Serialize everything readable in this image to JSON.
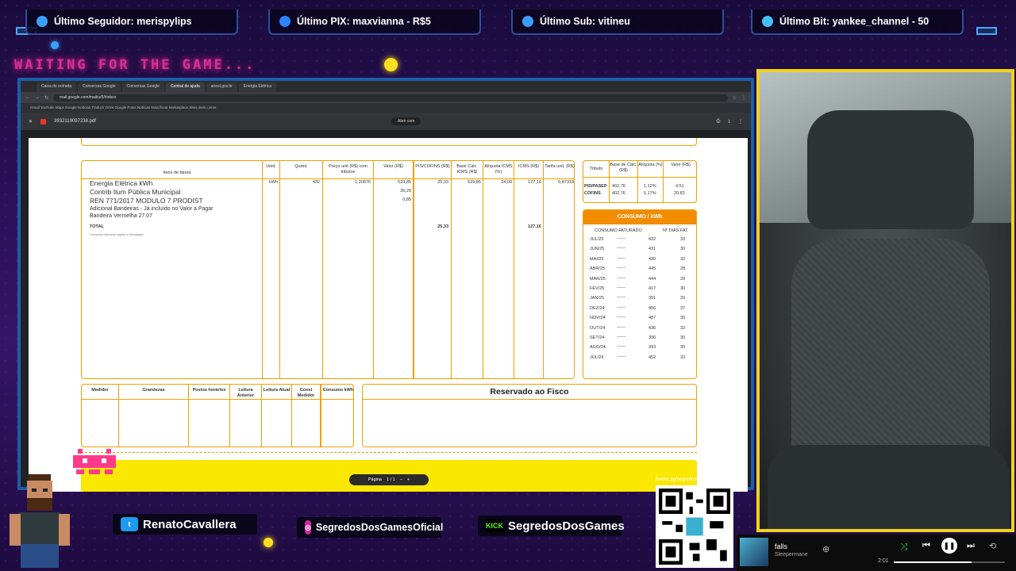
{
  "alerts": [
    "Último Seguidor: merispylips",
    "Último PIX: maxvianna - R$5",
    "Último Sub: vitineu",
    "Último Bit: yankee_channel - 50"
  ],
  "waiting": "WAITING FOR THE GAME...",
  "browser": {
    "tabs": [
      "Caixa de entrada",
      "Conversas Google",
      "Conversas Google",
      "Central de ajuda",
      "aneel.gov.br",
      "Energia Elétrica"
    ],
    "url": "mail.google.com/mail/u/0/#inbox",
    "bookmarks": "Gmail  YouTube  Maps  Google Notícias  Traduzir  Drive  Google Fotos  Notícias  Nota fiscal  Marketplace  Sites úteis  Livros",
    "pdf_name": "3932119097238.pdf",
    "open_with": "Abrir com",
    "page_label": "Página",
    "page_indicator": "1 / 1"
  },
  "invoice": {
    "headers": [
      "Itens de fatura",
      "Unid.",
      "Quant.",
      "Preço unit (R$) com tributos",
      "Valor (R$)",
      "PIS/COFINS (R$)",
      "Base Calc. ICMS (R$)",
      "Alíquota ICMS (%)",
      "ICMS (R$)",
      "Tarifa unit. (R$)"
    ],
    "lines": [
      "Energia Elétrica kWh",
      "Contrib Ilum Pública Municipal",
      "REN 771/2017 MODULO 7 PRODIST",
      "Adicional Bandeiras - Já incluído no Valor a Pagar",
      "Bandeira Vermelha 27.07"
    ],
    "total_label": "TOTAL",
    "footnote": "Consumo faturado sujeito a tributação",
    "unit": "kWh",
    "qty": "432",
    "price": "1,20876",
    "values": [
      "529,85",
      "26,26",
      "0,85"
    ],
    "pis": "25,33",
    "base": "529,85",
    "rate": "24,00",
    "icms": "127,16",
    "tariff": "0,87318",
    "pis_total": "25,33",
    "icms_total": "127,16"
  },
  "taxes": {
    "headers": [
      "Tributo",
      "Base de Cálc. (R$)",
      "Alíquota (%)",
      "Valor (R$)"
    ],
    "rows": [
      {
        "name": "PIS/PASEP",
        "base": "402,76",
        "rate": "1,12%",
        "value": "4,51"
      },
      {
        "name": "COFINS",
        "base": "402,76",
        "rate": "5,17%",
        "value": "20,82"
      }
    ]
  },
  "consumption": {
    "title": "CONSUMO / kWh",
    "headers": [
      "CONSUMO FATURADO",
      "Nº DIAS FAT."
    ],
    "rows": [
      {
        "month": "JUL/25",
        "kwh": "432",
        "days": "33"
      },
      {
        "month": "JUN/25",
        "kwh": "431",
        "days": "30"
      },
      {
        "month": "MAI/25",
        "kwh": "430",
        "days": "32"
      },
      {
        "month": "ABR/25",
        "kwh": "445",
        "days": "28"
      },
      {
        "month": "MAR/25",
        "kwh": "444",
        "days": "29"
      },
      {
        "month": "FEV/25",
        "kwh": "417",
        "days": "30"
      },
      {
        "month": "JAN/25",
        "kwh": "391",
        "days": "29"
      },
      {
        "month": "DEZ/24",
        "kwh": "456",
        "days": "37"
      },
      {
        "month": "NOV/24",
        "kwh": "487",
        "days": "30"
      },
      {
        "month": "OUT/24",
        "kwh": "436",
        "days": "32"
      },
      {
        "month": "SET/24",
        "kwh": "396",
        "days": "30"
      },
      {
        "month": "AGO/24",
        "kwh": "393",
        "days": "30"
      },
      {
        "month": "JUL/24",
        "kwh": "452",
        "days": "33"
      }
    ]
  },
  "meter": {
    "headers": [
      "Medidor",
      "Grandezas",
      "Postos horários",
      "Leitura Anterior",
      "Leitura Atual",
      "Const Medidor",
      "Consumo kWh"
    ]
  },
  "fisco_title": "Reservado ao Fisco",
  "socials": [
    "RenatoCavallera",
    "SegredosDosGamesOficial",
    "SegredosDosGames"
  ],
  "kick_logo": "KICK",
  "qr_label": "livepix.gg/segredosdosgames",
  "music": {
    "title": "falls",
    "artist": "Sleepermane",
    "elapsed": "2:01",
    "progress": 0.7
  }
}
